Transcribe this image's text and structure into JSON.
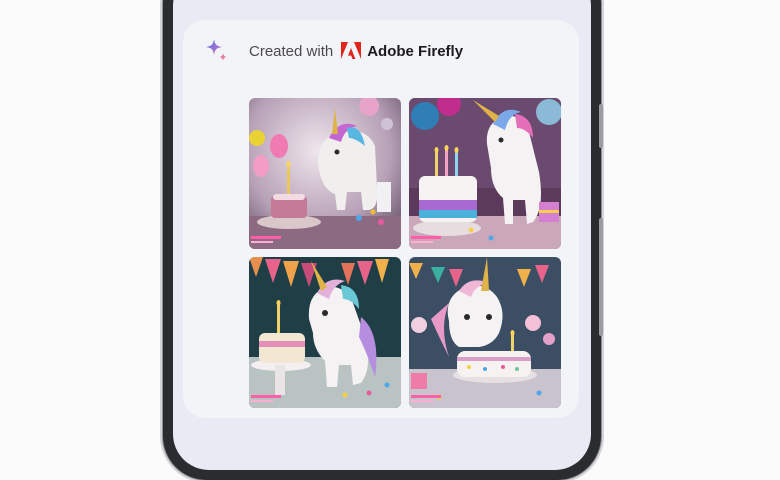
{
  "header": {
    "created_with_label": "Created with",
    "brand_name": "Adobe Firefly",
    "sparkle_icon": "gemini-sparkle-icon",
    "brand_icon": "adobe-logo-icon"
  },
  "gallery": {
    "images": [
      {
        "subject": "unicorn-with-birthday-cake-and-balloons"
      },
      {
        "subject": "unicorn-with-candle-cake-and-balloons"
      },
      {
        "subject": "unicorn-with-cake-and-bunting"
      },
      {
        "subject": "unicorn-with-cake-and-confetti"
      }
    ]
  },
  "colors": {
    "card_background": "#f3f4f8",
    "screen_background": "#e8ebf3",
    "adobe_red": "#e1251b",
    "phone_frame": "#2b2c30"
  }
}
